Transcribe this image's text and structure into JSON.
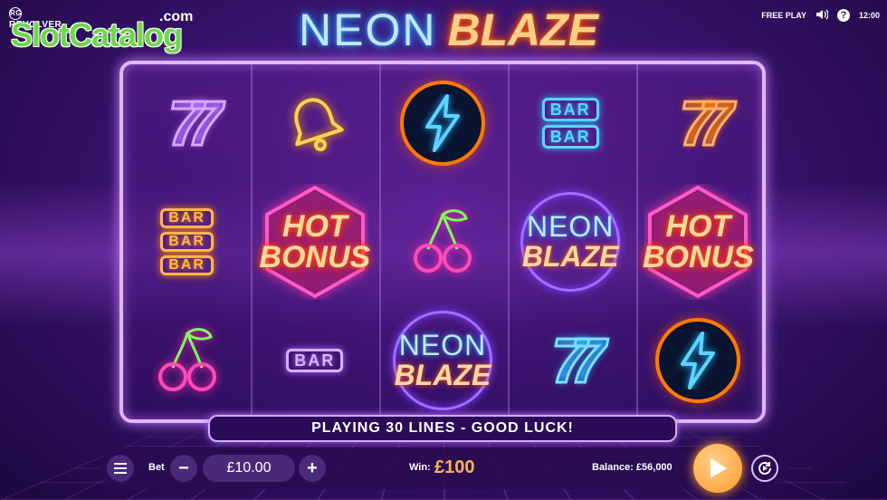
{
  "watermark": {
    "provider": "REVOLVER",
    "provider_badge": "RG",
    "site": "SlotCatalog",
    "domain": ".com"
  },
  "game": {
    "title_part1": "NEON",
    "title_part2": "BLAZE"
  },
  "topbar": {
    "mode": "FREE PLAY",
    "help": "?",
    "clock": "12:00",
    "sound_icon": "speaker-icon"
  },
  "reels": [
    [
      "seven-purple",
      "bar-triple-orange",
      "cherry"
    ],
    [
      "bell",
      "hot-bonus",
      "bar-single-purple"
    ],
    [
      "lightning-bolt",
      "cherry",
      "neon-blaze-wild"
    ],
    [
      "bar-double-blue",
      "neon-blaze-wild",
      "seven-blue"
    ],
    [
      "seven-orange",
      "hot-bonus",
      "lightning-bolt"
    ]
  ],
  "symbol_text": {
    "bar": "BAR",
    "hot": "HOT",
    "bonus": "BONUS",
    "neon": "NEON",
    "blaze": "BLAZE"
  },
  "message": "PLAYING 30 LINES - GOOD LUCK!",
  "controls": {
    "bet_label": "Bet",
    "bet_value": "£10.00",
    "minus": "−",
    "plus": "+",
    "win_label": "Win:",
    "win_value": "£100",
    "balance": "Balance: £56,000"
  },
  "colors": {
    "accent_orange": "#ff9a2a",
    "neon_purple": "#b46bff",
    "neon_blue": "#27b8ff"
  }
}
